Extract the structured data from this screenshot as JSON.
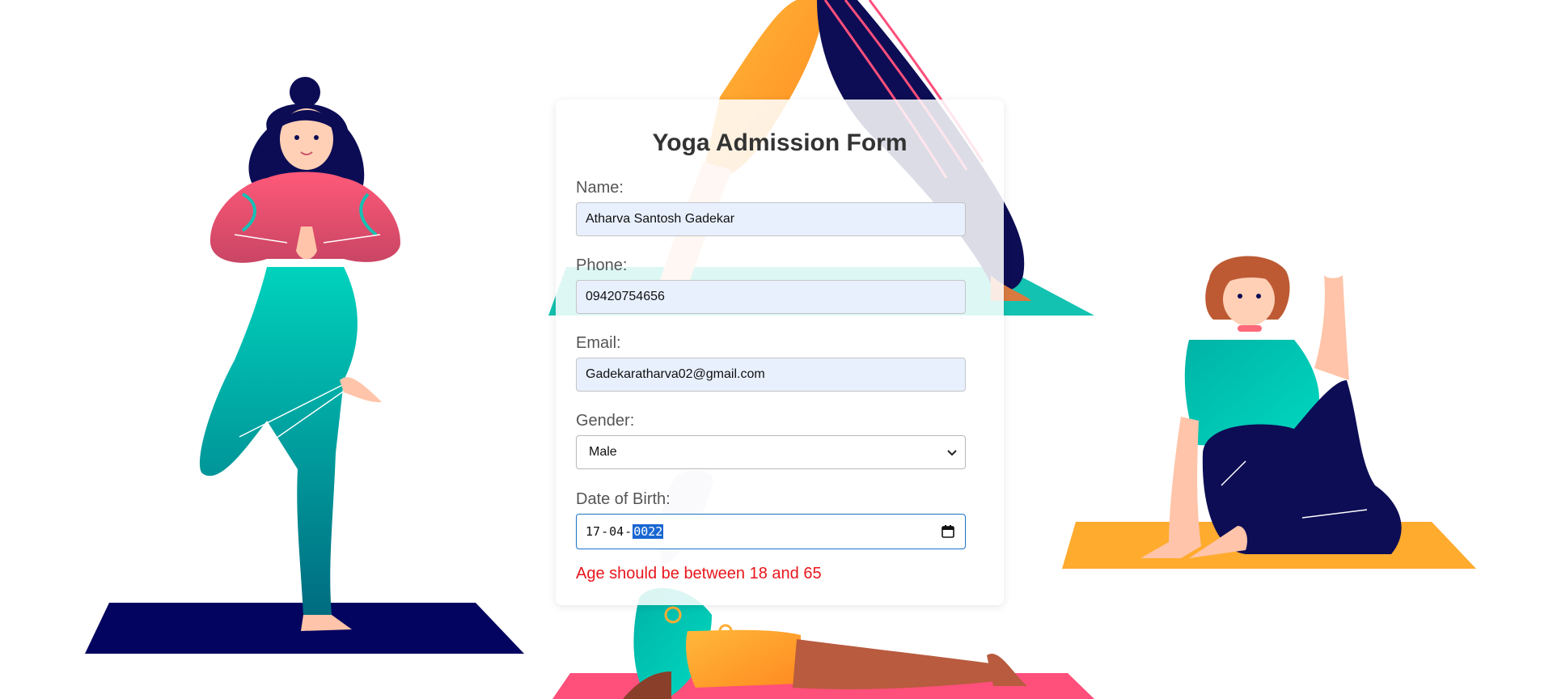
{
  "form": {
    "title": "Yoga Admission Form",
    "fields": {
      "name": {
        "label": "Name:",
        "value": "Atharva Santosh Gadekar"
      },
      "phone": {
        "label": "Phone:",
        "value": "09420754656"
      },
      "email": {
        "label": "Email:",
        "value": "Gadekaratharva02@gmail.com"
      },
      "gender": {
        "label": "Gender:",
        "value": "Male"
      },
      "dob": {
        "label": "Date of Birth:",
        "day": "17",
        "month": "04",
        "year": "0022",
        "separator": "-"
      }
    },
    "error": "Age should be between 18 and 65"
  },
  "illustrations": [
    "yoga-woman-tree-pose",
    "yoga-person-downward-dog",
    "yoga-person-seated-twist",
    "yoga-person-cobra-pose"
  ],
  "colors": {
    "error": "#e8161c",
    "autofill_bg": "#e8f0fe",
    "focus_border": "#1a73c8",
    "teal": "#00c9b7",
    "navy": "#0b0b5a",
    "orange": "#ffad33",
    "pink": "#ff4f7b"
  }
}
